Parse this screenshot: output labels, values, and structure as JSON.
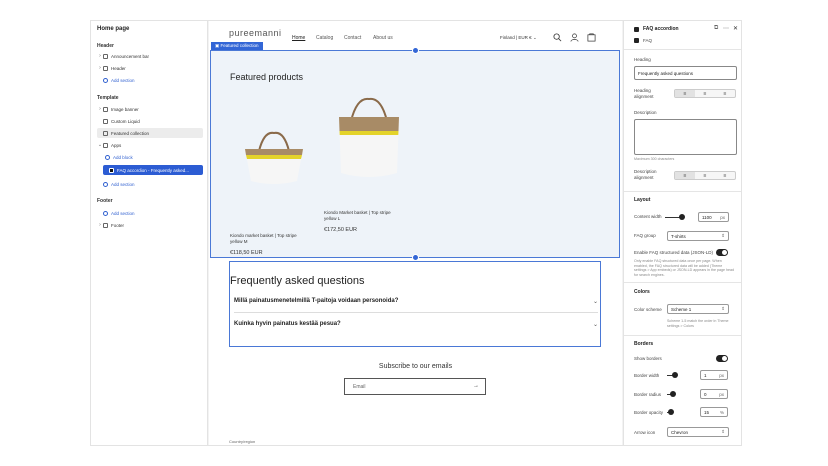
{
  "sidebar": {
    "title": "Home page",
    "header_group": "Header",
    "header_items": [
      "Announcement bar",
      "Header"
    ],
    "add_section": "Add section",
    "template_group": "Template",
    "template_items": [
      "Image banner",
      "Custom Liquid",
      "Featured collection",
      "Apps"
    ],
    "add_block": "Add block",
    "app_block": "FAQ accordion - Frequently asked...",
    "footer_group": "Footer",
    "footer_items": [
      "Footer"
    ]
  },
  "store": {
    "logo": "pureemanni",
    "nav": [
      "Home",
      "Catalog",
      "Contact",
      "About us"
    ],
    "region": "Finland | EUR €",
    "section_tag": "Featured collection",
    "featured_title": "Featured products",
    "products": [
      {
        "name": "Kiondo market basket | Top stripe yellow M",
        "price": "€118,50 EUR"
      },
      {
        "name": "Kiondo Market basket | Top stripe yellow L",
        "price": "€172,50 EUR"
      }
    ],
    "faq_title": "Frequently asked questions",
    "faq_items": [
      "Millä painatusmenetelmillä T-paitoja voidaan personoida?",
      "Kuinka hyvin painatus kestää pesua?"
    ],
    "subscribe": "Subscribe to our emails",
    "email_placeholder": "Email",
    "country": "Country/region"
  },
  "panel": {
    "title": "FAQ accordion",
    "app_name": "FAQ",
    "heading_label": "Heading",
    "heading_value": "Frequently asked questions",
    "heading_alignment_label": "Heading alignment",
    "description_label": "Description",
    "description_hint": "Maximum 300 characters",
    "description_alignment_label": "Description alignment",
    "layout_label": "Layout",
    "content_width_label": "Content width",
    "content_width_value": "1100",
    "content_width_unit": "px",
    "faq_group_label": "FAQ group",
    "faq_group_value": "T-shirts",
    "structured_data_label": "Enable FAQ structured data (JSON-LD)",
    "structured_data_hint": "Only enable FAQ structured data once per page. When enabled, the FAQ structured data will be added (Theme settings > App embeds) or JSON-LD appears in the page head for search engines.",
    "colors_label": "Colors",
    "color_scheme_label": "Color scheme",
    "color_scheme_value": "Scheme 1",
    "color_scheme_hint": "Scheme 1-5 match the order in Theme settings > Colors",
    "borders_label": "Borders",
    "show_borders_label": "Show borders",
    "border_width_label": "Border width",
    "border_width_value": "1",
    "border_radius_label": "Border radius",
    "border_radius_value": "0",
    "border_opacity_label": "Border opacity",
    "border_opacity_value": "15",
    "arrow_icon_label": "Arrow icon",
    "arrow_icon_value": "Chevron",
    "px": "px",
    "pct": "%"
  },
  "accent_color": "#2c5cd3"
}
